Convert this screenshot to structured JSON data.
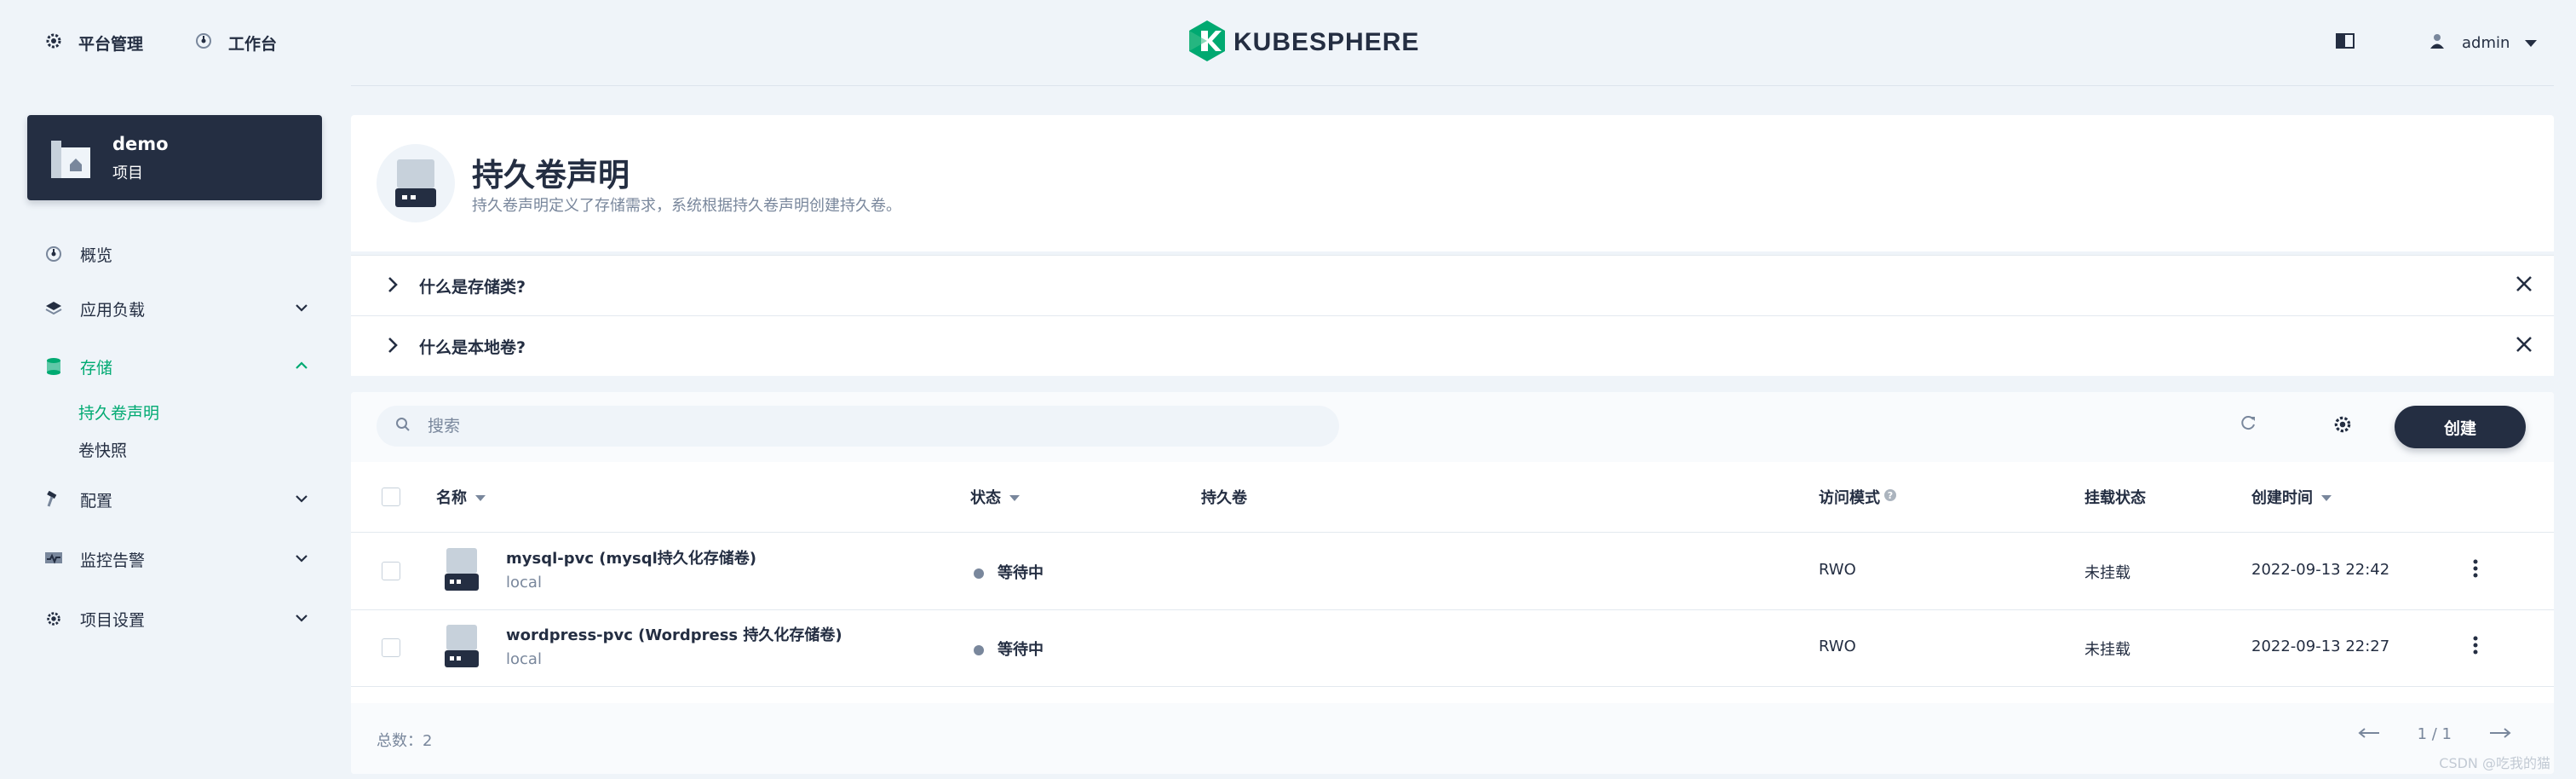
{
  "topbar": {
    "platform_label": "平台管理",
    "workbench_label": "工作台",
    "logo_text": "KUBESPHERE",
    "user_name": "admin"
  },
  "project": {
    "name": "demo",
    "type": "项目"
  },
  "sidebar": {
    "items": [
      {
        "label": "概览"
      },
      {
        "label": "应用负载"
      },
      {
        "label": "存储"
      },
      {
        "label": "配置"
      },
      {
        "label": "监控告警"
      },
      {
        "label": "项目设置"
      }
    ],
    "storage_sub": [
      {
        "label": "持久卷声明"
      },
      {
        "label": "卷快照"
      }
    ]
  },
  "banner": {
    "title": "持久卷声明",
    "description": "持久卷声明定义了存储需求，系统根据持久卷声明创建持久卷。"
  },
  "tips": [
    {
      "label": "什么是存储类?"
    },
    {
      "label": "什么是本地卷?"
    }
  ],
  "toolbar": {
    "search_placeholder": "搜索",
    "create_label": "创建"
  },
  "table": {
    "columns": {
      "name": "名称",
      "status": "状态",
      "volume": "持久卷",
      "access_mode": "访问模式",
      "mount_status": "挂载状态",
      "created": "创建时间"
    },
    "rows": [
      {
        "name": "mysql-pvc (mysql持久化存储卷)",
        "storage_class": "local",
        "status": "等待中",
        "volume": "",
        "access_mode": "RWO",
        "mount_status": "未挂载",
        "created": "2022-09-13 22:42"
      },
      {
        "name": "wordpress-pvc (Wordpress 持久化存储卷)",
        "storage_class": "local",
        "status": "等待中",
        "volume": "",
        "access_mode": "RWO",
        "mount_status": "未挂载",
        "created": "2022-09-13 22:27"
      }
    ]
  },
  "footer": {
    "total": "总数：2",
    "page": "1 / 1"
  },
  "watermark": "CSDN @吃我的猫",
  "colors": {
    "accent": "#00aa72",
    "dark": "#242e42",
    "muted": "#79879c",
    "background": "#eff4f9"
  }
}
